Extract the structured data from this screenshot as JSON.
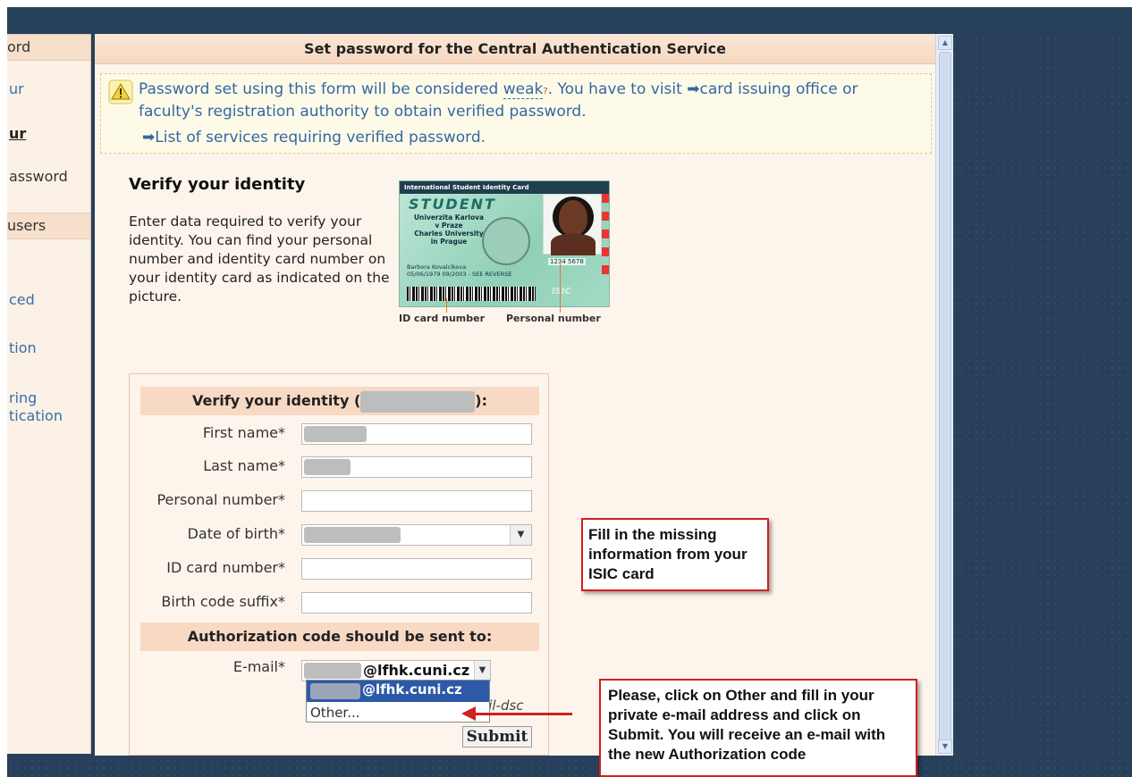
{
  "sidebar": {
    "head1": "ord",
    "link1": "ur",
    "link2": "ur",
    "link3": "assword",
    "head2": "users",
    "link4": "ced",
    "link5": "tion",
    "link6a": "ring",
    "link6b": "tication"
  },
  "main": {
    "title": "Set password for the Central Authentication Service"
  },
  "warning": {
    "text_pre": "Password set using this form will be considered ",
    "weak_word": "weak",
    "qmark": "?",
    "text_mid": ". You have to visit ",
    "link_card_office": "card issuing office or faculty's registration authority",
    "text_post": " to obtain verified password.",
    "link_services": "List of services requiring verified password.",
    "arrow": "➡"
  },
  "verify": {
    "heading": "Verify your identity",
    "description": "Enter data required to verify your identity. You can find your personal number and identity card number on your identity card as indicated on the picture."
  },
  "isic_card": {
    "top": "International Student Identity Card",
    "student": "STUDENT",
    "uni_line1": "Univerzita Karlova",
    "uni_line2": "v Praze",
    "uni_line3": "Charles University",
    "uni_line4": "in Prague",
    "number": "1234 5678",
    "holder": "Barbora Kovalcikova",
    "dates": "05/06/1979   09/2003 - SEE REVERSE",
    "isic": "ISIC",
    "caption_id": "ID card number",
    "caption_personal": "Personal number"
  },
  "form": {
    "heading_pre": "Verify your identity (",
    "heading_post": "):",
    "fields": {
      "first_name": "First name*",
      "last_name": "Last name*",
      "personal_number": "Personal number*",
      "date_of_birth": "Date of birth*",
      "id_card_number": "ID card number*",
      "birth_code_suffix": "Birth code suffix*"
    },
    "auth_heading": "Authorization code should be sent to:",
    "email_label": "E-mail*",
    "email_suffix": "@lfhk.cuni.cz",
    "dropdown_selected": "@lfhk.cuni.cz",
    "dropdown_other": "Other...",
    "hint_partial": "ail-dsc",
    "submit_label": "Submit"
  },
  "callouts": {
    "missing_info": "Fill in the missing information from your ISIC card",
    "instructions": "Please, click on Other and fill in your private e-mail address and click on Submit. You will receive an e-mail with the new Authorization code"
  },
  "colors": {
    "accent_link": "#3566a4",
    "callout_border": "#d21f1f",
    "header_bg": "#f7d9c4",
    "selected_option": "#2c5aa8"
  },
  "icons": {
    "warning": "warning-triangle-icon",
    "arrow": "right-arrow-icon",
    "dropdown": "chevron-down-icon",
    "scroll_up": "scroll-up-icon",
    "scroll_down": "scroll-down-icon"
  }
}
